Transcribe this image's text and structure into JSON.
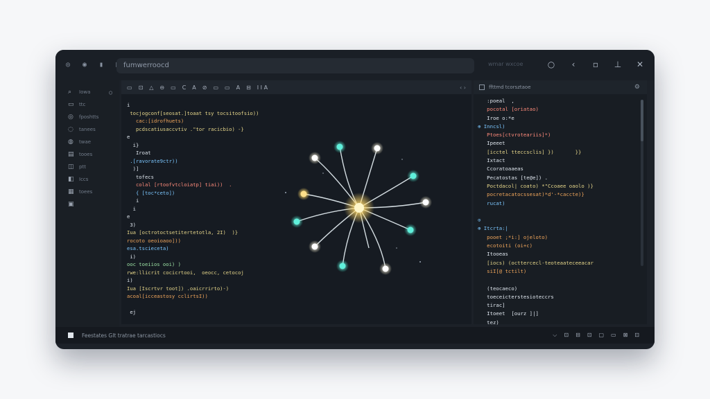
{
  "titlebar": {
    "left_icons": [
      "circle-icon",
      "shield-icon",
      "bar-icon",
      "box-icon"
    ],
    "title": "fumwerroocd",
    "ghost": "wmar wxcoe",
    "right_icons": [
      "minimize-icon",
      "share-icon",
      "copy-icon",
      "pin-icon",
      "close-icon"
    ],
    "right_glyphs": [
      "○",
      "‹",
      "▫",
      "⊥",
      "✕"
    ]
  },
  "sidebar": {
    "items": [
      {
        "icon": "search-icon",
        "glyph": "⌕",
        "label": "Iowa",
        "tail": "○"
      },
      {
        "icon": "files-icon",
        "glyph": "▭",
        "label": "ttc",
        "tail": ""
      },
      {
        "icon": "branch-icon",
        "glyph": "◎",
        "label": "fposhtts",
        "tail": ""
      },
      {
        "icon": "debug-icon",
        "glyph": "◌",
        "label": "tanees",
        "tail": ""
      },
      {
        "icon": "extensions-icon",
        "glyph": "◍",
        "label": "twae",
        "tail": ""
      },
      {
        "icon": "list-icon",
        "glyph": "▤",
        "label": "tooes",
        "tail": ""
      },
      {
        "icon": "play-icon",
        "glyph": "◫",
        "label": "ptt",
        "tail": ""
      },
      {
        "icon": "cube-icon",
        "glyph": "◧",
        "label": "Iccs",
        "tail": ""
      },
      {
        "icon": "grid-icon",
        "glyph": "▦",
        "label": "toees",
        "tail": ""
      },
      {
        "icon": "box-icon",
        "glyph": "▣",
        "label": "",
        "tail": ""
      }
    ]
  },
  "editor": {
    "toolbar": [
      "▭",
      "⊡",
      "△",
      "⊖",
      "▭",
      "C",
      "A",
      "⊘",
      "▭",
      "▭",
      "A",
      "⊟",
      "I I A"
    ],
    "toolbar_right": "‹ ›",
    "lines": [
      {
        "t": "i",
        "c": "c-w"
      },
      {
        "t": " tocjogconf[seosat.]toaat tsy tocsitoofsio))",
        "c": "c-y"
      },
      {
        "t": "   cac:[idrofhuets)",
        "c": "c-o"
      },
      {
        "t": "   pcdscatiusaccvtiv .\"tor racicbio) -}",
        "c": "c-y"
      },
      {
        "t": "e",
        "c": "c-w"
      },
      {
        "t": "  i}",
        "c": "c-w"
      },
      {
        "t": "   Iroat",
        "c": "c-w"
      },
      {
        "t": " .[ravorate9ctr))",
        "c": "c-b"
      },
      {
        "t": "  )]",
        "c": "c-w"
      },
      {
        "t": "   tofecs",
        "c": "c-w"
      },
      {
        "t": "   colal [rtoofvtcloiatp] tiai))  .",
        "c": "c-r"
      },
      {
        "t": "   { [toc*ceto])",
        "c": "c-b"
      },
      {
        "t": "   i",
        "c": "c-w"
      },
      {
        "t": "  i",
        "c": "c-w"
      },
      {
        "t": "e",
        "c": "c-w"
      },
      {
        "t": " 3)",
        "c": "c-w"
      },
      {
        "t": "Iua [octrotoctsetitertetotla, 2I)  )}",
        "c": "c-y"
      },
      {
        "t": "rocoto oeoioaoo]))",
        "c": "c-o"
      },
      {
        "t": "esa.tscieceta)",
        "c": "c-b"
      },
      {
        "t": " i)",
        "c": "c-w"
      },
      {
        "t": "ooc toeiios ooi) )",
        "c": "c-g"
      },
      {
        "t": "rwe:llicrit cocicrtooi,  oeocc, cetocoj",
        "c": "c-y"
      },
      {
        "t": "i)",
        "c": "c-w"
      },
      {
        "t": "Iua [Iscrtvr toot]) .oaicrrirto)-)",
        "c": "c-y"
      },
      {
        "t": "acoal[icceastosy cclirtsI))",
        "c": "c-o"
      },
      {
        "t": "",
        "c": "c-w"
      },
      {
        "t": " ej",
        "c": "c-w"
      }
    ]
  },
  "panel": {
    "title": "ffttmd tcorsztaoe",
    "lines": [
      {
        "t": "   :poeal  ,",
        "c": "c-w"
      },
      {
        "t": "   pocotal [oriatao)",
        "c": "c-r"
      },
      {
        "t": "   Iroe o:*e",
        "c": "c-w"
      },
      {
        "t": "⊕ Inncsl)",
        "c": "c-b"
      },
      {
        "t": "   Ptoes[ctvroteariis]*)",
        "c": "c-r"
      },
      {
        "t": "   Ipeeet",
        "c": "c-w"
      },
      {
        "t": "   [icctel tteccsclis] })       }}",
        "c": "c-y"
      },
      {
        "t": "   Ixtact",
        "c": "c-w"
      },
      {
        "t": "   Ccoratoaaeas",
        "c": "c-w"
      },
      {
        "t": "   Pecatostas [te@e]) .",
        "c": "c-w"
      },
      {
        "t": "   Poctdacol| coato) *\"Ccoaee oaolo )}",
        "c": "c-y"
      },
      {
        "t": "   pocretacatocssesat)*d'-*caccte)}",
        "c": "c-o"
      },
      {
        "t": "   rucat)",
        "c": "c-b"
      },
      {
        "t": "",
        "c": "c-w"
      },
      {
        "t": "⊙",
        "c": "c-b"
      },
      {
        "t": "⊕ Itcrta:|",
        "c": "c-b"
      },
      {
        "t": "   pooet ;*i:] ojeloto)",
        "c": "c-o"
      },
      {
        "t": "   ecotoiti (oi+c)",
        "c": "c-o"
      },
      {
        "t": "   Itooeas",
        "c": "c-w"
      },
      {
        "t": "   [iocs) (octtercecl-teoteaateceeacar",
        "c": "c-y"
      },
      {
        "t": "   siI[@ tctilt)",
        "c": "c-o"
      },
      {
        "t": "",
        "c": "c-w"
      },
      {
        "t": "   (teocaeco)",
        "c": "c-w"
      },
      {
        "t": "   toeceicterstesioteccrs",
        "c": "c-w"
      },
      {
        "t": "   tirac]",
        "c": "c-w"
      },
      {
        "t": "   Itoeet  [ourz ]|]",
        "c": "c-w"
      },
      {
        "t": "   tez)",
        "c": "c-w"
      }
    ]
  },
  "statusbar": {
    "text": "Feestates GIt tratrae tarcastiocs",
    "right": [
      "⌵",
      "⊡",
      "⊟",
      "⊡",
      "▢",
      "▭",
      "⊠",
      "⊡"
    ]
  }
}
